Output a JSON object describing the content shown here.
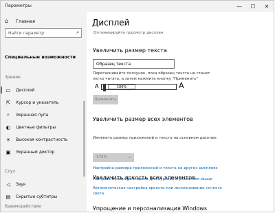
{
  "window": {
    "title": "Параметры",
    "controls": {
      "minimize": "—",
      "maximize": "☐",
      "close": "✕"
    }
  },
  "sidebar": {
    "home_label": "Главная",
    "search_placeholder": "Найти параметр",
    "section_title": "Специальные возможности",
    "groups": [
      {
        "label": "Зрение",
        "items": [
          {
            "label": "Дисплей",
            "icon": "monitor-icon",
            "glyph": "▭",
            "selected": true
          },
          {
            "label": "Курсор и указатель",
            "icon": "pointer-icon",
            "glyph": "⇱",
            "selected": false
          },
          {
            "label": "Экранная лупа",
            "icon": "magnifier-icon",
            "glyph": "⌕",
            "selected": false
          },
          {
            "label": "Цветные фильтры",
            "icon": "color-filter-icon",
            "glyph": "◐",
            "selected": false
          },
          {
            "label": "Высокая контрастность",
            "icon": "contrast-icon",
            "glyph": "☀",
            "selected": false
          },
          {
            "label": "Экранный диктор",
            "icon": "narrator-icon",
            "glyph": "▣",
            "selected": false
          }
        ]
      },
      {
        "label": "Слух",
        "items": [
          {
            "label": "Звук",
            "icon": "speaker-icon",
            "glyph": "◁",
            "selected": false
          },
          {
            "label": "Скрытые субтитры",
            "icon": "captions-icon",
            "glyph": "▤",
            "selected": false
          }
        ]
      },
      {
        "label": "Взаимодействие",
        "items": []
      }
    ]
  },
  "content": {
    "page_title": "Дисплей",
    "subtitle": "Оптимизируйте просмотр дисплея.",
    "text_size": {
      "heading": "Увеличить размер текста",
      "sample_value": "Образец текста",
      "description": "Перетаскивайте ползунок, пока образец текста не станет легко читать, а затем нажмите кнопку \"Применить\"",
      "slider_small_label": "A",
      "slider_big_label": "A",
      "slider_value": "100%",
      "slider_fraction": 0.0,
      "apply_label": "Применить"
    },
    "scale": {
      "heading": "Увеличить размер всех элементов",
      "label": "Изменить размер приложений и текста на основном дисплее",
      "dropdown_value": "175%",
      "links": [
        "Настройка размера приложений и текста на других дисплеях",
        "Настройка размера и цвета для курсора и указателя мыши"
      ]
    },
    "brightness": {
      "heading": "Увеличить яркость всех элементов",
      "link_line1": "Автоматическая настройка яркости или использование ночного",
      "link_line2": "света"
    },
    "simplify": {
      "heading": "Упрощение и персонализация Windows"
    }
  }
}
